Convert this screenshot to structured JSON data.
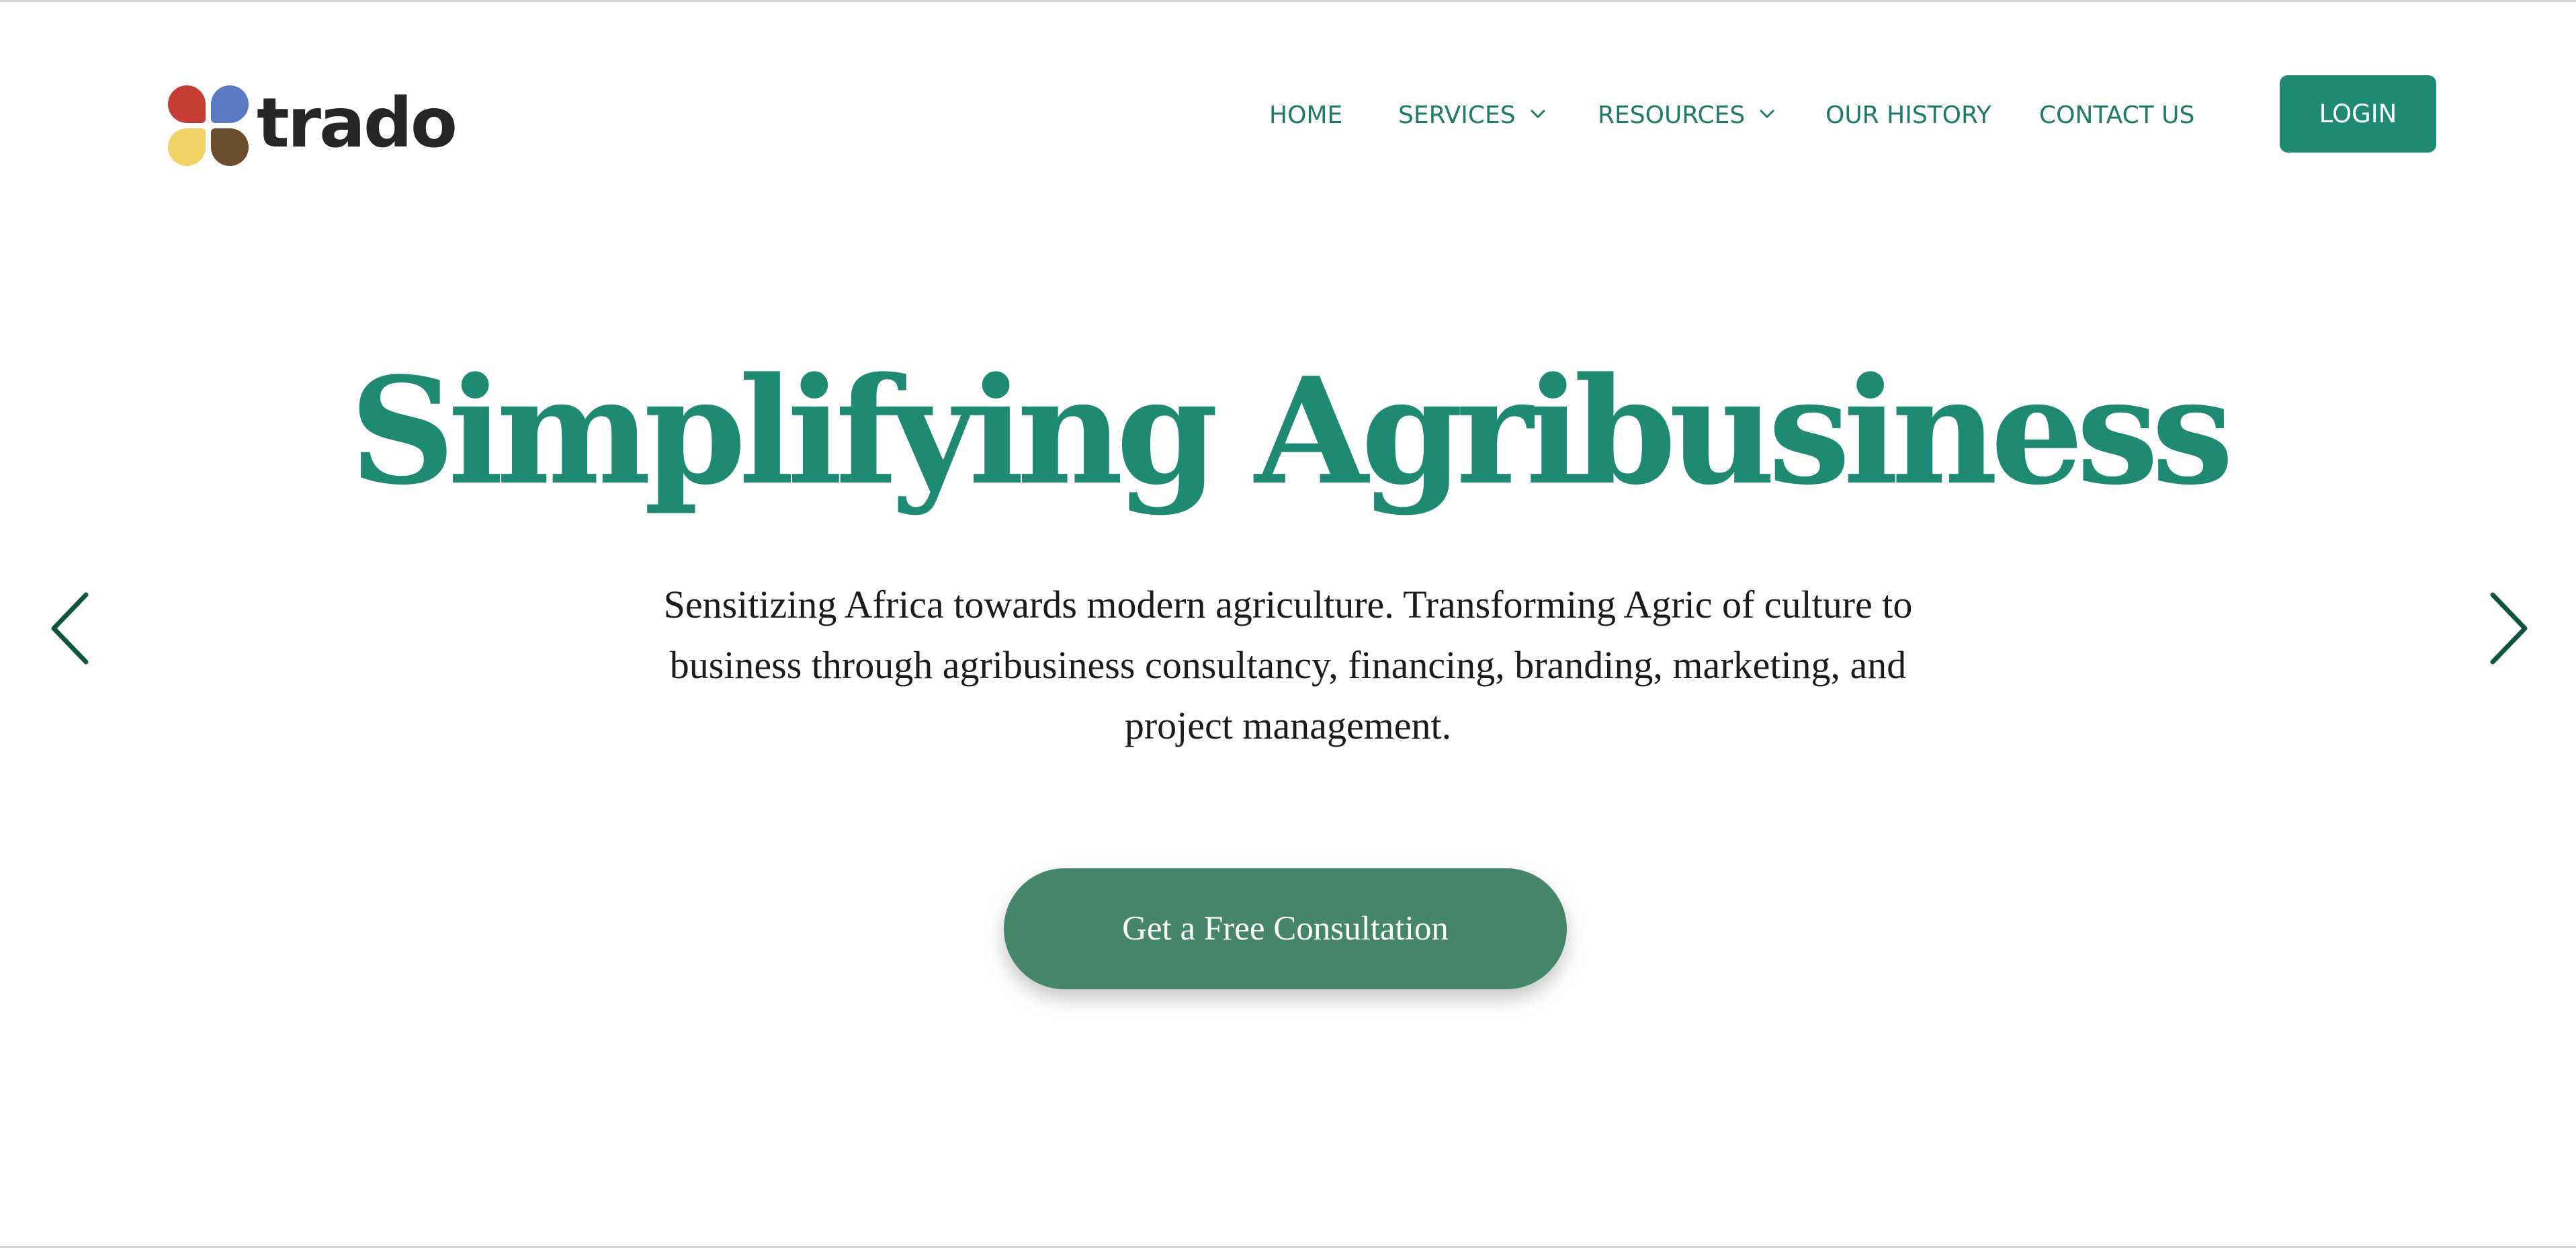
{
  "colors": {
    "brand": "#1e8a74",
    "nav_text": "#1f7a66",
    "cta": "#458569",
    "arrow": "#0f5440",
    "logo_red": "#c63d36",
    "logo_blue": "#5b7ac4",
    "logo_yellow": "#f0d265",
    "logo_brown": "#6b4d2e",
    "logo_text": "#262626"
  },
  "header": {
    "logo": {
      "text": "trado",
      "icon": "four-petal-logo-icon"
    },
    "nav": {
      "items": [
        {
          "label": "HOME"
        },
        {
          "label": "SERVICES",
          "icon": "chevron-down-icon"
        },
        {
          "label": "RESOURCES",
          "icon": "chevron-down-icon"
        },
        {
          "label": "OUR HISTORY"
        },
        {
          "label": "CONTACT US"
        }
      ]
    },
    "login_label": "LOGIN"
  },
  "hero": {
    "title": "Simplifying Agribusiness",
    "subtitle": "Sensitizing Africa towards modern agriculture. Transforming Agric of culture to business through agribusiness consultancy, financing, branding, marketing, and project management.",
    "cta_label": "Get a Free Consultation",
    "prev_icon": "chevron-left-icon",
    "next_icon": "chevron-right-icon"
  }
}
